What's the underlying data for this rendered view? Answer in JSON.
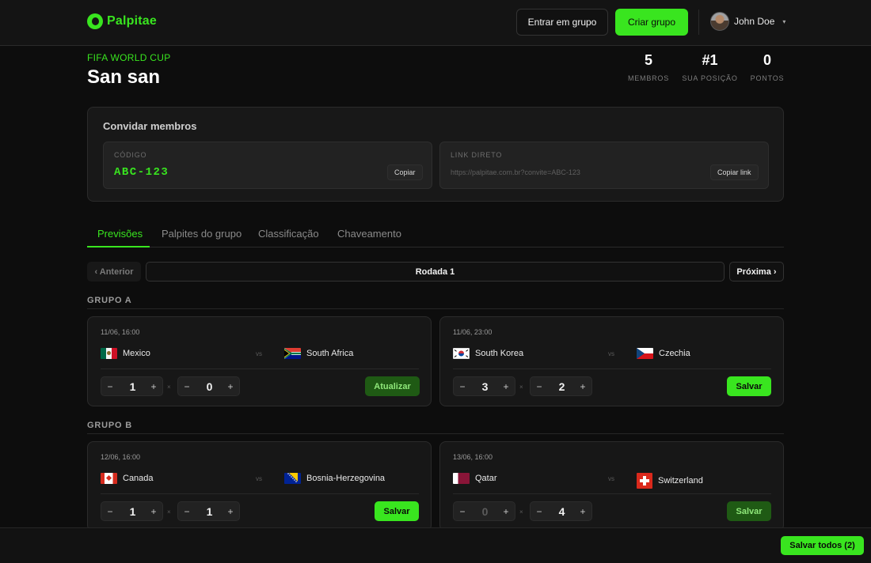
{
  "header": {
    "brand": "Palpitae",
    "join_label": "Entrar em grupo",
    "create_label": "Criar grupo",
    "user_name": "John Doe",
    "caret": "▾"
  },
  "group": {
    "competition": "FIFA WORLD CUP",
    "name": "San san",
    "stats": [
      {
        "value": "5",
        "label": "MEMBROS"
      },
      {
        "value": "#1",
        "label": "SUA POSIÇÃO"
      },
      {
        "value": "0",
        "label": "PONTOS"
      }
    ]
  },
  "invite": {
    "title": "Convidar membros",
    "code_label": "CÓDIGO",
    "code": "ABC-123",
    "copy_label": "Copiar",
    "link_label": "LINK DIRETO",
    "link": "https://palpitae.com.br?convite=ABC-123",
    "copy_link_label": "Copiar link"
  },
  "tabs": [
    {
      "label": "Previsões",
      "active": true
    },
    {
      "label": "Palpites do grupo",
      "active": false
    },
    {
      "label": "Classificação",
      "active": false
    },
    {
      "label": "Chaveamento",
      "active": false
    }
  ],
  "round": {
    "prev": "‹ Anterior",
    "label": "Rodada 1",
    "next": "Próxima ›"
  },
  "groups": [
    {
      "name": "GRUPO A",
      "matches": [
        {
          "time": "11/06, 16:00",
          "home": "Mexico",
          "away": "South Africa",
          "home_score": "1",
          "away_score": "0",
          "action": "Atualizar",
          "action_style": "dark"
        },
        {
          "time": "11/06, 23:00",
          "home": "South Korea",
          "away": "Czechia",
          "home_score": "3",
          "away_score": "2",
          "action": "Salvar",
          "action_style": "bright"
        }
      ]
    },
    {
      "name": "GRUPO B",
      "matches": [
        {
          "time": "12/06, 16:00",
          "home": "Canada",
          "away": "Bosnia-Herzegovina",
          "home_score": "1",
          "away_score": "1",
          "action": "Salvar",
          "action_style": "bright"
        },
        {
          "time": "13/06, 16:00",
          "home": "Qatar",
          "away": "Switzerland",
          "home_score": "0",
          "away_score": "4",
          "action": "Salvar",
          "action_style": "dark"
        }
      ]
    }
  ],
  "common": {
    "vs": "vs",
    "times": "×",
    "minus": "−",
    "plus": "+"
  },
  "footer": {
    "save_all": "Salvar todos (2)"
  },
  "colors": {
    "accent": "#39e51f",
    "accent_dark": "#1f5a14",
    "background": "#0d0d0d",
    "card": "#171717"
  }
}
